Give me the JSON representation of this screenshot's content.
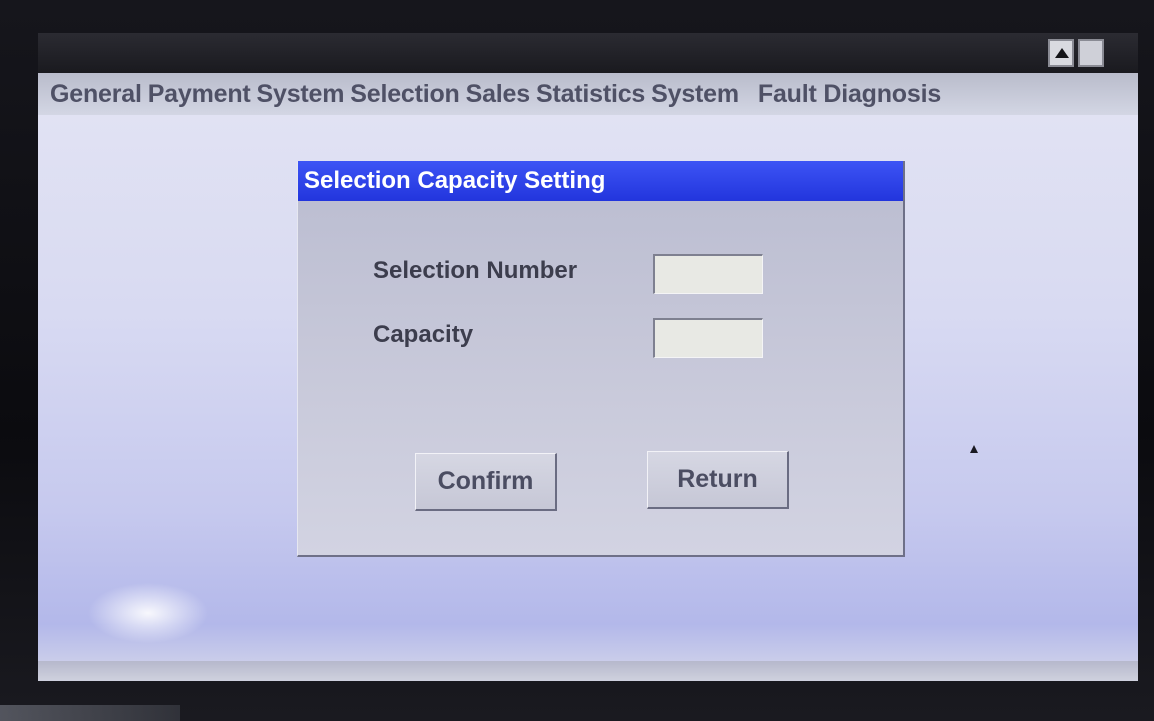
{
  "menu": {
    "items": [
      {
        "label": "General"
      },
      {
        "label": "Payment"
      },
      {
        "label": "System"
      },
      {
        "label": "Selection"
      },
      {
        "label": "Sales"
      },
      {
        "label": "Statistics"
      },
      {
        "label": "System"
      },
      {
        "label": "Fault Diagnosis"
      }
    ]
  },
  "dialog": {
    "title": "Selection Capacity Setting",
    "fields": {
      "selection_number": {
        "label": "Selection Number",
        "value": ""
      },
      "capacity": {
        "label": "Capacity",
        "value": ""
      }
    },
    "buttons": {
      "confirm": "Confirm",
      "return": "Return"
    }
  },
  "window_controls": {
    "scroll_up_icon": "triangle-up-icon",
    "blank_button_icon": "square-icon"
  },
  "colors": {
    "dialog_title_bar": "#2f45ea",
    "menu_text": "#4f5166",
    "screen_background": "#d6d8ef"
  }
}
